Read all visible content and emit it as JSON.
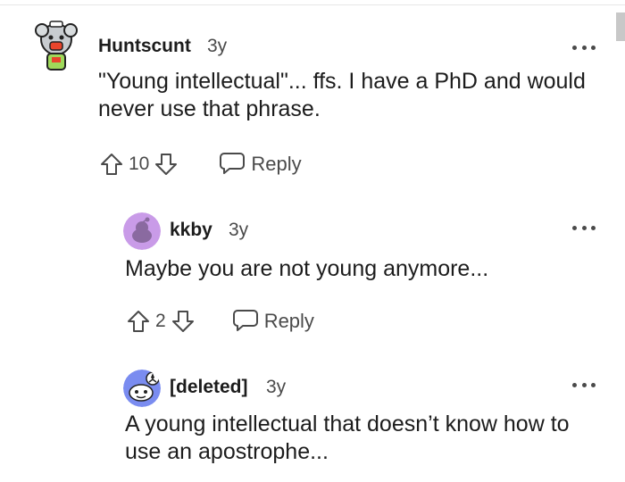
{
  "comments": [
    {
      "author": "Huntscunt",
      "age": "3y",
      "body": "\"Young intellectual\"... ffs. I have a PhD and would never use that phrase.",
      "score": "10",
      "reply_label": "Reply"
    },
    {
      "author": "kkby",
      "age": "3y",
      "body": "Maybe you are not young anymore...",
      "score": "2",
      "reply_label": "Reply"
    },
    {
      "author": "[deleted]",
      "age": "3y",
      "body": "A young intellectual that doesn’t know how to use an apostrophe..."
    }
  ],
  "icons": {
    "upvote": "arrow-up-outline-icon",
    "downvote": "arrow-down-outline-icon",
    "reply": "speech-bubble-icon",
    "more": "overflow-dots-icon"
  },
  "colors": {
    "text": "#1c1c1c",
    "meta": "#4a4a4a",
    "avatar_purple": "#c99be8",
    "avatar_blue": "#7a8cf0"
  }
}
